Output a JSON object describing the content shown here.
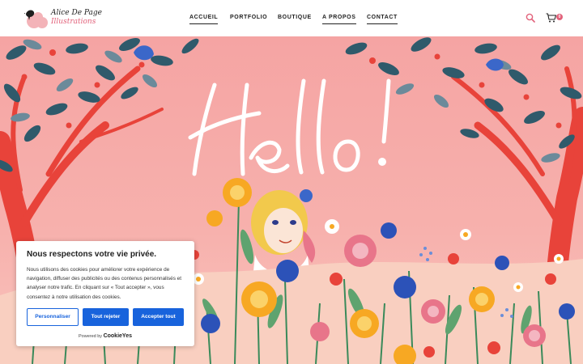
{
  "brand": {
    "name_line1": "Alice De Page",
    "name_line2": "Illustrations"
  },
  "nav": {
    "items": [
      {
        "label": "ACCUEIL",
        "active": true
      },
      {
        "label": "PORTFOLIO",
        "active": false
      },
      {
        "label": "BOUTIQUE",
        "active": false
      },
      {
        "label": "A PROPOS",
        "active": true
      },
      {
        "label": "CONTACT",
        "active": true
      }
    ]
  },
  "header_icons": {
    "search": "search-icon",
    "cart": "cart-icon",
    "cart_count": "0"
  },
  "hero": {
    "headline": "Hello!",
    "background_color": "#f4a7a6"
  },
  "cookie_banner": {
    "title": "Nous respectons votre vie privée.",
    "body": "Nous utilisons des cookies pour améliorer votre expérience de navigation, diffuser des publicités ou des contenus personnalisés et analyser notre trafic. En cliquant sur « Tout accepter », vous consentez à notre utilisation des cookies.",
    "buttons": {
      "customize": "Personnaliser",
      "reject": "Tout rejeter",
      "accept": "Accepter tout"
    },
    "powered_prefix": "Powered by",
    "powered_brand": "CookieYes",
    "accent_color": "#1863dc"
  },
  "colors": {
    "brand_pink": "#e2617a",
    "text_dark": "#222222"
  }
}
